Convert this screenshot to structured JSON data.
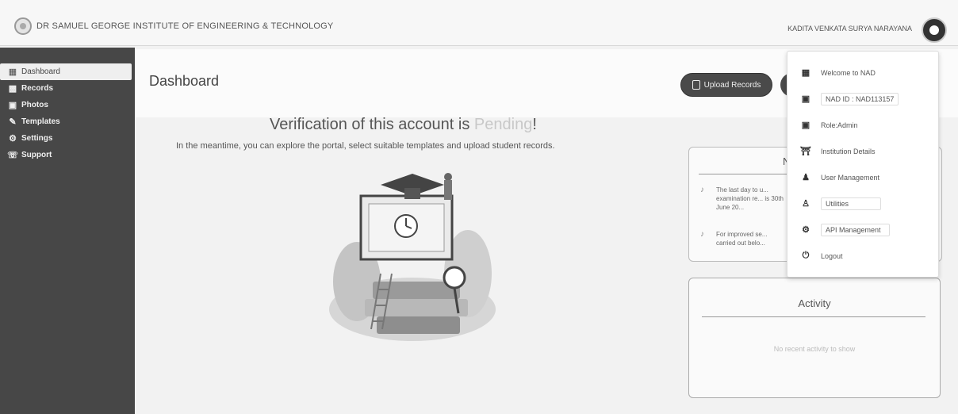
{
  "header": {
    "institute_name": "DR SAMUEL GEORGE INSTITUTE OF ENGINEERING & TECHNOLOGY",
    "user_name": "KADITA VENKATA SURYA NARAYANA"
  },
  "sidebar": {
    "items": [
      {
        "label": "Dashboard",
        "icon": "calendar-icon"
      },
      {
        "label": "Records",
        "icon": "document-icon"
      },
      {
        "label": "Photos",
        "icon": "photo-icon"
      },
      {
        "label": "Templates",
        "icon": "pen-icon"
      },
      {
        "label": "Settings",
        "icon": "gear-icon"
      },
      {
        "label": "Support",
        "icon": "headset-icon"
      }
    ]
  },
  "main": {
    "title": "Dashboard",
    "upload_button": "Upload Records",
    "verification_prefix": "Verification of this account is ",
    "verification_status": "Pending",
    "verification_suffix": "!",
    "verification_subtitle": "In the meantime, you can explore the portal, select suitable templates and upload student records."
  },
  "notifications": {
    "title": "N",
    "items": [
      {
        "text": "The last day to u... examination re... is 30th June 20..."
      },
      {
        "text": "For improved se... carried out belo..."
      }
    ]
  },
  "activity": {
    "title": "Activity",
    "empty_text": "No recent activity to show"
  },
  "user_menu": {
    "items": [
      {
        "label": "Welcome to NAD",
        "icon": "building-icon"
      },
      {
        "label": "NAD ID : NAD113157",
        "icon": "id-card-icon"
      },
      {
        "label": "Role:Admin",
        "icon": "id-card-icon"
      },
      {
        "label": "Institution Details",
        "icon": "institution-icon"
      },
      {
        "label": "User Management",
        "icon": "users-icon"
      },
      {
        "label": "Utilities",
        "icon": "user-icon"
      },
      {
        "label": "API Management",
        "icon": "gears-icon"
      },
      {
        "label": "Logout",
        "icon": "power-icon"
      }
    ]
  }
}
